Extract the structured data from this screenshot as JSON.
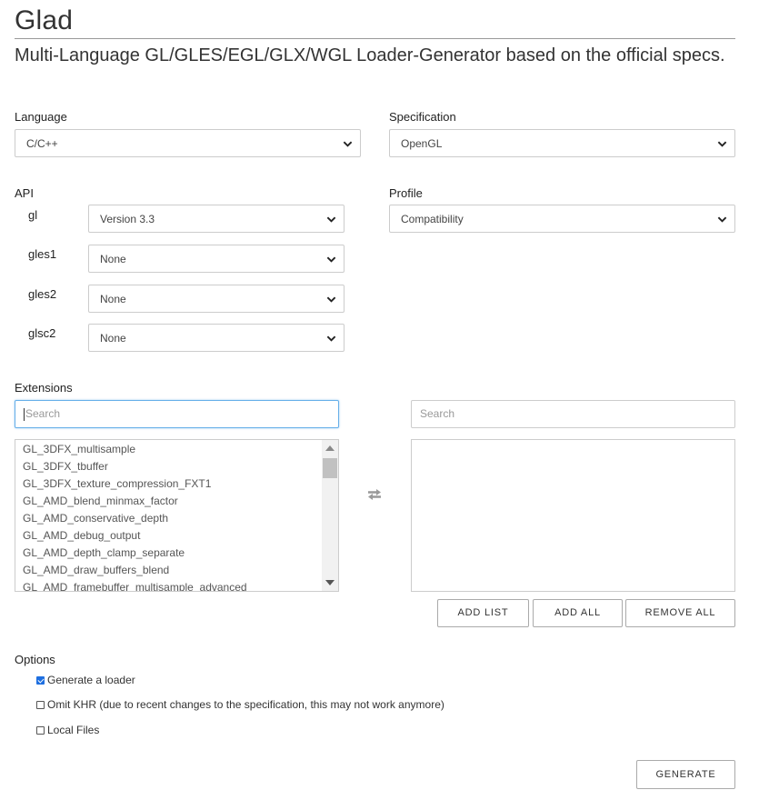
{
  "header": {
    "title": "Glad",
    "subtitle": "Multi-Language GL/GLES/EGL/GLX/WGL Loader-Generator based on the official specs."
  },
  "language": {
    "label": "Language",
    "value": "C/C++"
  },
  "specification": {
    "label": "Specification",
    "value": "OpenGL"
  },
  "api": {
    "label": "API",
    "rows": [
      {
        "name": "gl",
        "value": "Version 3.3"
      },
      {
        "name": "gles1",
        "value": "None"
      },
      {
        "name": "gles2",
        "value": "None"
      },
      {
        "name": "glsc2",
        "value": "None"
      }
    ]
  },
  "profile": {
    "label": "Profile",
    "value": "Compatibility"
  },
  "extensions": {
    "label": "Extensions",
    "left_search_placeholder": "Search",
    "right_search_placeholder": "Search",
    "available": [
      "GL_3DFX_multisample",
      "GL_3DFX_tbuffer",
      "GL_3DFX_texture_compression_FXT1",
      "GL_AMD_blend_minmax_factor",
      "GL_AMD_conservative_depth",
      "GL_AMD_debug_output",
      "GL_AMD_depth_clamp_separate",
      "GL_AMD_draw_buffers_blend",
      "GL_AMD_framebuffer_multisample_advanced"
    ],
    "selected": [],
    "buttons": {
      "add_list": "ADD LIST",
      "add_all": "ADD ALL",
      "remove_all": "REMOVE ALL"
    }
  },
  "options": {
    "label": "Options",
    "items": [
      {
        "label": "Generate a loader",
        "checked": true
      },
      {
        "label": "Omit KHR (due to recent changes to the specification, this may not work anymore)",
        "checked": false
      },
      {
        "label": "Local Files",
        "checked": false
      }
    ]
  },
  "generate_label": "GENERATE",
  "icons": {
    "select_arrow": "chevron-down-icon",
    "transfer": "swap-arrows-icon",
    "checkbox": "checkbox-icon"
  },
  "colors": {
    "focus_border": "#66afe9",
    "checkbox_checked": "#1e6fe0",
    "border": "#cccccc"
  }
}
